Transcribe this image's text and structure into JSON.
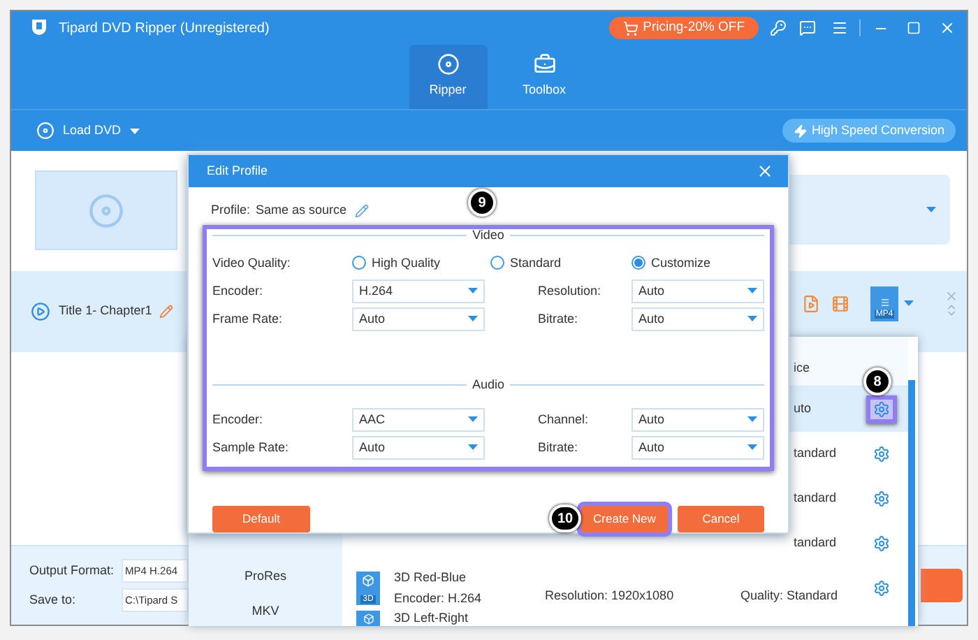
{
  "window": {
    "title": "Tipard DVD Ripper (Unregistered)",
    "pricing_button": "Pricing-20% OFF"
  },
  "main_tabs": [
    {
      "label": "Ripper",
      "selected": true
    },
    {
      "label": "Toolbox",
      "selected": false
    }
  ],
  "toolbar": {
    "load_button": "Load DVD",
    "speed_button": "High Speed Conversion"
  },
  "title_item": {
    "label": "Title 1- Chapter1",
    "format_badge": "MP4"
  },
  "bottom_bar": {
    "output_format_label": "Output Format:",
    "output_format_value": "MP4 H.264",
    "save_to_label": "Save to:",
    "save_to_value": "C:\\Tipard S"
  },
  "profile_list": {
    "header": "ice",
    "categories": [
      {
        "label": "ProRes"
      },
      {
        "label": "MKV"
      }
    ],
    "profiles": [
      {
        "kind": "partial",
        "text": "uto",
        "selected": true,
        "gear_highlighted": true
      },
      {
        "kind": "partial",
        "text": "tandard",
        "selected": false,
        "gear_highlighted": false
      },
      {
        "kind": "partial",
        "text": "tandard",
        "selected": false,
        "gear_highlighted": false
      },
      {
        "kind": "partial",
        "text": "tandard",
        "selected": false,
        "gear_highlighted": false
      },
      {
        "kind": "full",
        "name": "3D Red-Blue",
        "badge": "3D",
        "encoder": "Encoder: H.264",
        "resolution": "Resolution: 1920x1080",
        "quality": "Quality: Standard",
        "selected": false,
        "gear_highlighted": false
      },
      {
        "kind": "name_only",
        "name": "3D Left-Right",
        "selected": false
      }
    ]
  },
  "dialog": {
    "title": "Edit Profile",
    "profile_label": "Profile:",
    "profile_value": "Same as source",
    "video": {
      "heading": "Video",
      "quality_label": "Video Quality:",
      "quality_options": [
        {
          "label": "High Quality",
          "selected": false
        },
        {
          "label": "Standard",
          "selected": false
        },
        {
          "label": "Customize",
          "selected": true
        }
      ],
      "fields": [
        {
          "label": "Encoder:",
          "value": "H.264"
        },
        {
          "label": "Resolution:",
          "value": "Auto"
        },
        {
          "label": "Frame Rate:",
          "value": "Auto"
        },
        {
          "label": "Bitrate:",
          "value": "Auto"
        }
      ]
    },
    "audio": {
      "heading": "Audio",
      "fields": [
        {
          "label": "Encoder:",
          "value": "AAC"
        },
        {
          "label": "Channel:",
          "value": "Auto"
        },
        {
          "label": "Sample Rate:",
          "value": "Auto"
        },
        {
          "label": "Bitrate:",
          "value": "Auto"
        }
      ]
    },
    "buttons": [
      {
        "label": "Default",
        "highlighted": false
      },
      {
        "label": "Create New",
        "highlighted": true
      },
      {
        "label": "Cancel",
        "highlighted": false
      }
    ]
  },
  "step_markers": [
    {
      "label": "9"
    },
    {
      "label": "8"
    },
    {
      "label": "10"
    }
  ]
}
